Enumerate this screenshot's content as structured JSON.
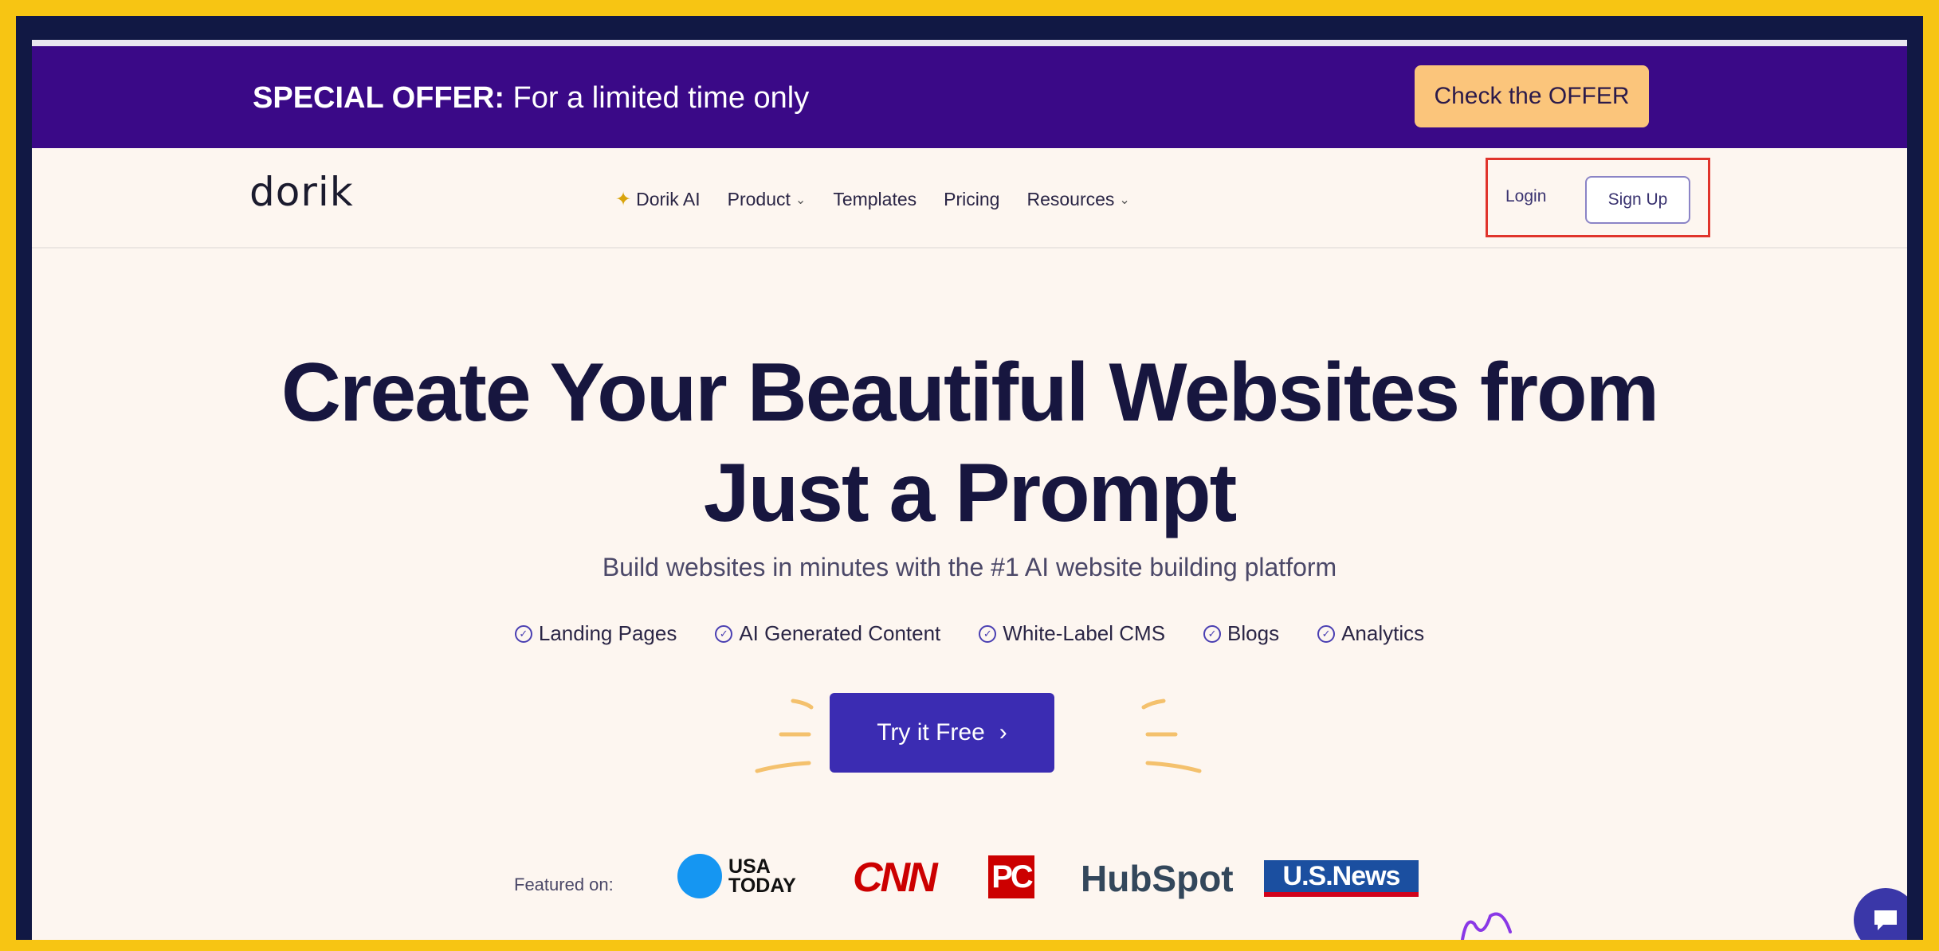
{
  "offer_bar": {
    "label_bold": "SPECIAL OFFER:",
    "label_rest": " For a limited time only",
    "button": "Check the OFFER"
  },
  "navbar": {
    "logo": "dorik",
    "links": [
      {
        "label": "Dorik AI",
        "icon": "sparkle-icon"
      },
      {
        "label": "Product",
        "dropdown": true
      },
      {
        "label": "Templates"
      },
      {
        "label": "Pricing"
      },
      {
        "label": "Resources",
        "dropdown": true
      }
    ],
    "login": "Login",
    "signup": "Sign Up"
  },
  "hero": {
    "title_line1": "Create Your Beautiful Websites from",
    "title_line2": "Just a Prompt",
    "subtitle": "Build websites in minutes with the #1 AI website building platform",
    "features": [
      "Landing Pages",
      "AI Generated Content",
      "White-Label CMS",
      "Blogs",
      "Analytics"
    ],
    "cta": "Try it Free"
  },
  "featured": {
    "label": "Featured on:",
    "logos": {
      "usa_today_line1": "USA",
      "usa_today_line2": "TODAY",
      "cnn": "CNN",
      "pc": "PC",
      "hubspot": "HubSpot",
      "usnews": "U.S.News"
    }
  },
  "colors": {
    "outer_border": "#f7c513",
    "offer_bar": "#3a0987",
    "offer_button": "#fbc57b",
    "cta": "#3b2cb2",
    "highlight_box": "#e0342c",
    "page_bg": "#fdf6f0"
  }
}
